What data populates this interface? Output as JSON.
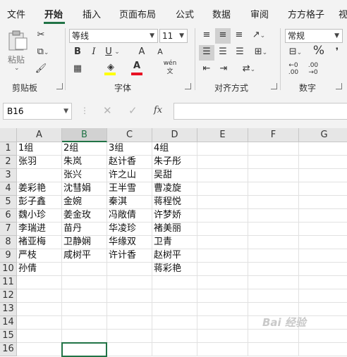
{
  "tabs": [
    "文件",
    "开始",
    "插入",
    "页面布局",
    "公式",
    "数据",
    "审阅",
    "方方格子",
    "视"
  ],
  "active_tab": "开始",
  "clipboard": {
    "paste_label": "粘贴",
    "group_label": "剪贴板"
  },
  "font": {
    "name": "等线",
    "size": "11",
    "group_label": "字体",
    "bold": "B",
    "italic": "I",
    "underline": "U",
    "grow": "A",
    "shrink": "A",
    "phonetic": "wén"
  },
  "alignment": {
    "group_label": "对齐方式"
  },
  "number": {
    "format": "常规",
    "group_label": "数字",
    "percent": "%"
  },
  "formula_bar": {
    "name_box": "B16",
    "fx": "fx",
    "value": ""
  },
  "columns": [
    "A",
    "B",
    "C",
    "D",
    "E",
    "F",
    "G"
  ],
  "selected_column": "B",
  "rows": [
    "1",
    "2",
    "3",
    "4",
    "5",
    "6",
    "7",
    "8",
    "9",
    "10",
    "11",
    "12",
    "13",
    "14",
    "15",
    "16"
  ],
  "cells": [
    [
      "1组",
      "2组",
      "3组",
      "4组"
    ],
    [
      "张羽",
      "朱岚",
      "赵计香",
      "朱子彤"
    ],
    [
      "",
      "张兴",
      "许之山",
      "吴甜"
    ],
    [
      "姜彩艳",
      "沈彗娟",
      "王半雪",
      "曹凌旋"
    ],
    [
      "彭子鑫",
      "金婉",
      "秦淇",
      "蒋程悦"
    ],
    [
      "魏小珍",
      "姜金玫",
      "冯敞倩",
      "许梦娇"
    ],
    [
      "李瑞进",
      "苗丹",
      "华凌珍",
      "褚美丽"
    ],
    [
      "褚亚梅",
      "卫静娴",
      "华缘双",
      "卫青"
    ],
    [
      "严枝",
      "咸树平",
      "许计香",
      "赵树平"
    ],
    [
      "孙倩",
      "",
      "",
      "蒋彩艳"
    ]
  ],
  "watermark": "Bai 经验"
}
